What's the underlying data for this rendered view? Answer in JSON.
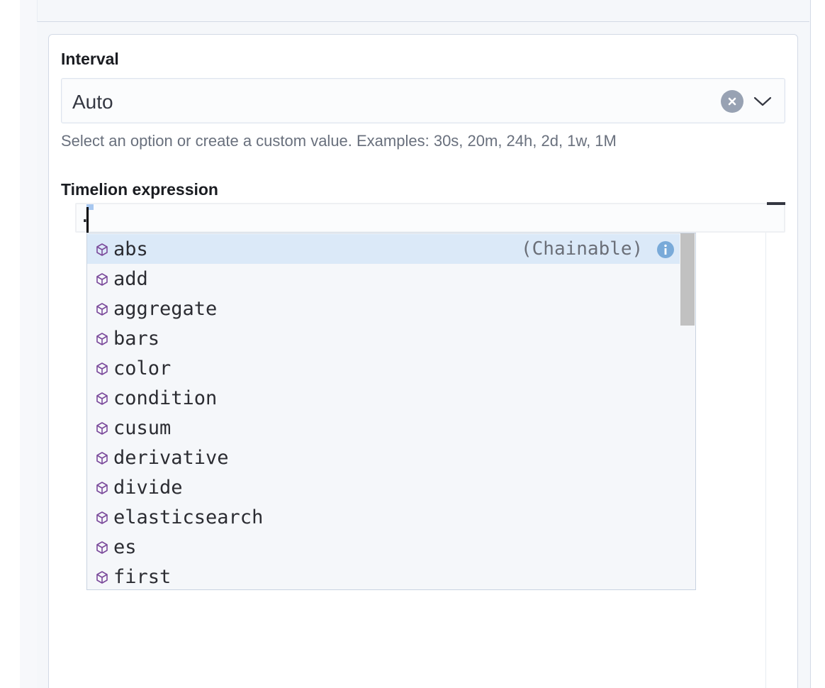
{
  "interval": {
    "label": "Interval",
    "value": "Auto",
    "help": "Select an option or create a custom value. Examples: 30s, 20m, 24h, 2d, 1w, 1M"
  },
  "timelion": {
    "label": "Timelion expression",
    "value": "."
  },
  "suggestions": {
    "items": [
      {
        "name": "abs",
        "tag": "(Chainable)",
        "selected": true
      },
      {
        "name": "add"
      },
      {
        "name": "aggregate"
      },
      {
        "name": "bars"
      },
      {
        "name": "color"
      },
      {
        "name": "condition"
      },
      {
        "name": "cusum"
      },
      {
        "name": "derivative"
      },
      {
        "name": "divide"
      },
      {
        "name": "elasticsearch"
      },
      {
        "name": "es"
      },
      {
        "name": "first"
      }
    ],
    "icon": "cube-icon",
    "info_icon": "info-icon",
    "colors": {
      "selected_bg": "#dbe9f8",
      "icon_color": "#7b4a9b",
      "info_color": "#79aad9"
    }
  }
}
